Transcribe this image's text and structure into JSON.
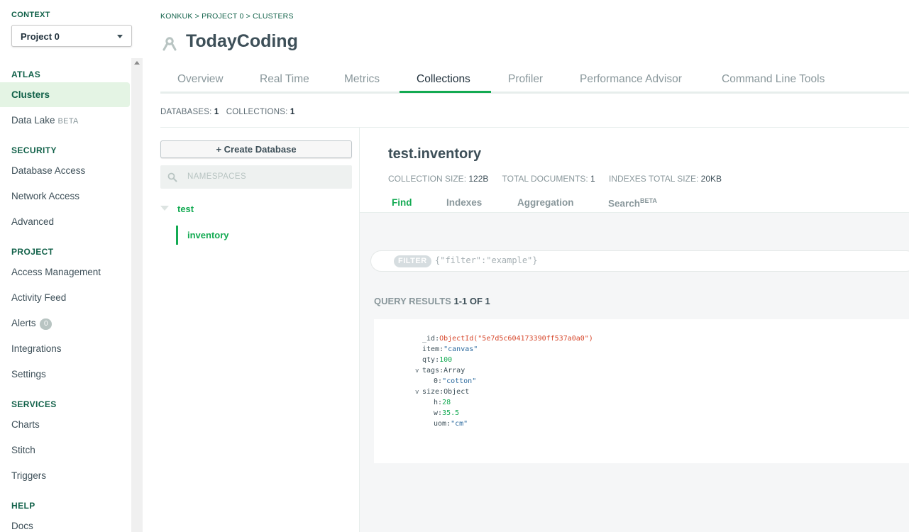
{
  "sidebar": {
    "context_label": "CONTEXT",
    "project": "Project 0",
    "sections": [
      {
        "title": "ATLAS",
        "items": [
          {
            "label": "Clusters"
          },
          {
            "label": "Data Lake",
            "tag": "BETA"
          }
        ]
      },
      {
        "title": "SECURITY",
        "items": [
          {
            "label": "Database Access"
          },
          {
            "label": "Network Access"
          },
          {
            "label": "Advanced"
          }
        ]
      },
      {
        "title": "PROJECT",
        "items": [
          {
            "label": "Access Management"
          },
          {
            "label": "Activity Feed"
          },
          {
            "label": "Alerts",
            "badge": "0"
          },
          {
            "label": "Integrations"
          },
          {
            "label": "Settings"
          }
        ]
      },
      {
        "title": "SERVICES",
        "items": [
          {
            "label": "Charts"
          },
          {
            "label": "Stitch"
          },
          {
            "label": "Triggers"
          }
        ]
      },
      {
        "title": "HELP",
        "items": [
          {
            "label": "Docs"
          }
        ]
      }
    ]
  },
  "breadcrumb": "KONKUK > PROJECT 0 > CLUSTERS",
  "page_title": "TodayCoding",
  "tabs": [
    "Overview",
    "Real Time",
    "Metrics",
    "Collections",
    "Profiler",
    "Performance Advisor",
    "Command Line Tools"
  ],
  "active_tab": "Collections",
  "counts": {
    "databases_label": "DATABASES:",
    "databases": "1",
    "collections_label": "COLLECTIONS:",
    "collections": "1"
  },
  "left_panel": {
    "create_db_label": "Create Database",
    "create_db_icon": "+",
    "search_placeholder": "NAMESPACES",
    "database": "test",
    "collection": "inventory"
  },
  "collection": {
    "title": "test.inventory",
    "size_label": "COLLECTION SIZE:",
    "size": "122B",
    "docs_label": "TOTAL DOCUMENTS:",
    "docs": "1",
    "indexes_label": "INDEXES TOTAL SIZE:",
    "indexes": "20KB",
    "subtabs": {
      "find": "Find",
      "indexes": "Indexes",
      "aggregation": "Aggregation",
      "search": "Search",
      "search_tag": "BETA"
    }
  },
  "filter": {
    "chip": "FILTER",
    "placeholder": "{\"filter\":\"example\"}"
  },
  "results": {
    "label": "QUERY RESULTS",
    "range": "1-1 OF 1"
  },
  "document": {
    "id_key": "_id",
    "id_val": "ObjectId(\"5e7d5c604173390ff537a0a0\")",
    "item_key": "item",
    "item_val": "\"canvas\"",
    "qty_key": "qty",
    "qty_val": "100",
    "tags_key": "tags",
    "tags_type": "Array",
    "tag0_key": "0",
    "tag0_val": "\"cotton\"",
    "size_key": "size",
    "size_type": "Object",
    "h_key": "h",
    "h_val": "28",
    "w_key": "w",
    "w_val": "35.5",
    "uom_key": "uom",
    "uom_val": "\"cm\""
  }
}
